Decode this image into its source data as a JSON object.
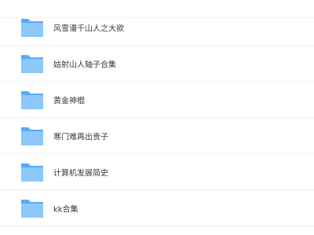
{
  "files": [
    {
      "name": "",
      "icon": "folder-icon"
    },
    {
      "name": "风雪漫千山人之大欲",
      "icon": "folder-icon"
    },
    {
      "name": "姑射山人轴子合集",
      "icon": "folder-icon"
    },
    {
      "name": "黄金神棍",
      "icon": "folder-icon"
    },
    {
      "name": "寒门难再出贵子",
      "icon": "folder-icon"
    },
    {
      "name": "计算机发展简史",
      "icon": "folder-icon"
    },
    {
      "name": "kk合集",
      "icon": "folder-icon"
    }
  ],
  "colors": {
    "folder_back": "#5aa8f4",
    "folder_front": "#8cc8fb",
    "text": "#333a44"
  }
}
